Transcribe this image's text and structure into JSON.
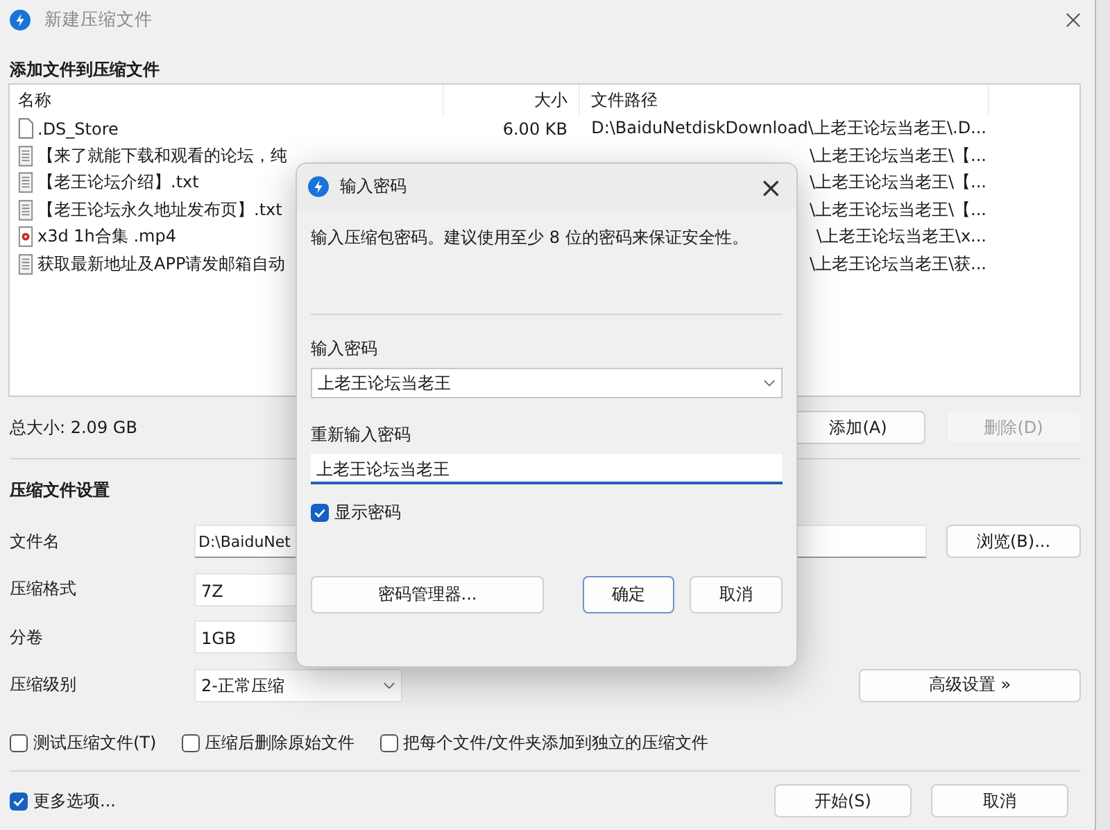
{
  "window": {
    "title": "新建压缩文件"
  },
  "files_section": {
    "heading": "添加文件到压缩文件",
    "columns": [
      "名称",
      "大小",
      "文件路径"
    ],
    "rows": [
      {
        "kind": "blank",
        "name": ".DS_Store",
        "size": "6.00 KB",
        "path": "D:\\BaiduNetdiskDownload\\上老王论坛当老王\\.D..."
      },
      {
        "kind": "text",
        "name": "【来了就能下载和观看的论坛，纯",
        "path": "\\上老王论坛当老王\\【..."
      },
      {
        "kind": "text",
        "name": "【老王论坛介绍】.txt",
        "path": "\\上老王论坛当老王\\【..."
      },
      {
        "kind": "text",
        "name": "【老王论坛永久地址发布页】.txt",
        "path": "\\上老王论坛当老王\\【..."
      },
      {
        "kind": "video",
        "name": "x3d 1h合集 .mp4",
        "path": "\\上老王论坛当老王\\x..."
      },
      {
        "kind": "text",
        "name": "获取最新地址及APP请发邮箱自动",
        "path": "\\上老王论坛当老王\\获..."
      }
    ],
    "total": "总大小: 2.09 GB",
    "buttons": [
      {
        "label": "添加(A)",
        "disabled": false
      },
      {
        "label": "删除(D)",
        "disabled": true
      }
    ]
  },
  "settings": {
    "heading": "压缩文件设置",
    "filename": {
      "label": "文件名",
      "value": "D:\\BaiduNet"
    },
    "browse_button": "浏览(B)...",
    "format": {
      "label": "压缩格式",
      "value": "7Z"
    },
    "split": {
      "label": "分卷",
      "value": "1GB"
    },
    "level": {
      "label": "压缩级别",
      "value": "2-正常压缩"
    },
    "advanced_button": "高级设置 »",
    "options": [
      {
        "label": "测试压缩文件(T)",
        "checked": false
      },
      {
        "label": "压缩后删除原始文件",
        "checked": false
      },
      {
        "label": "把每个文件/文件夹添加到独立的压缩文件",
        "checked": false
      }
    ]
  },
  "more_options": {
    "label": "更多选项...",
    "checked": true
  },
  "buttons": [
    "开始(S)",
    "取消"
  ],
  "password_dialog": {
    "title": "输入密码",
    "close": "×",
    "message": "输入压缩包密码。建议使用至少 8 位的密码来保证安全性。",
    "password": {
      "label": "输入密码",
      "value": "上老王论坛当老王"
    },
    "confirm": {
      "label": "重新输入密码",
      "value": "上老王论坛当老王"
    },
    "show_password": {
      "label": "显示密码",
      "checked": true
    },
    "buttons": {
      "manager": "密码管理器...",
      "ok": "确定",
      "cancel": "取消"
    }
  }
}
